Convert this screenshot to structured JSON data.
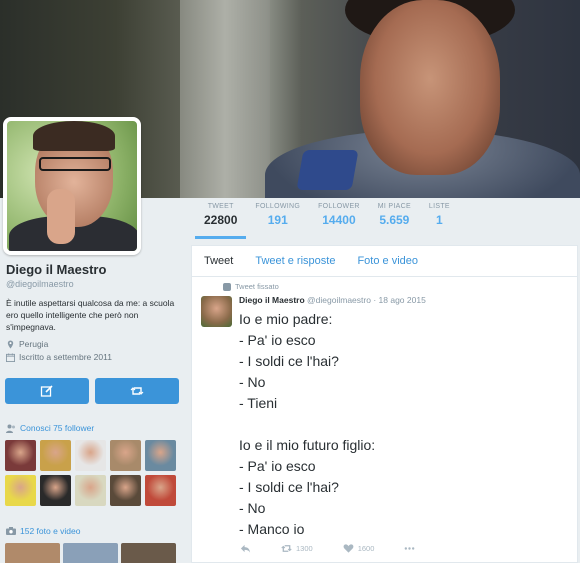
{
  "profile": {
    "name": "Diego il Maestro",
    "handle": "@diegoilmaestro",
    "bio": "È inutile aspettarsi qualcosa da me: a scuola ero quello intelligente che però non s'impegnava.",
    "location": "Perugia",
    "joined": "Iscritto a settembre 2011"
  },
  "stats": [
    {
      "label": "TWEET",
      "value": "22800"
    },
    {
      "label": "FOLLOWING",
      "value": "191"
    },
    {
      "label": "FOLLOWER",
      "value": "14400"
    },
    {
      "label": "MI PIACE",
      "value": "5.659"
    },
    {
      "label": "LISTE",
      "value": "1"
    }
  ],
  "tabs": [
    "Tweet",
    "Tweet e risposte",
    "Foto e video"
  ],
  "sidebar": {
    "followers_known": "Conosci 75 follower",
    "photos_videos": "152 foto e video",
    "follower_colors": [
      "#7a3a3a",
      "#c9a14a",
      "#e6e6e6",
      "#a88a6a",
      "#6a8aa0",
      "#e8d84a",
      "#2a2a2a",
      "#d8d8c0",
      "#5a4a3a",
      "#c04a3a"
    ],
    "photo_colors": [
      "#b08a6a",
      "#8aa0b8",
      "#6a5a4a"
    ]
  },
  "tweet": {
    "pinned_label": "Tweet fissato",
    "author": "Diego il Maestro",
    "handle": "@diegoilmaestro",
    "date": "18 ago 2015",
    "lines": [
      "Io e mio padre:",
      "- Pa' io esco",
      "- I soldi ce l'hai?",
      "- No",
      "- Tieni",
      "",
      "Io e il mio futuro figlio:",
      "- Pa' io esco",
      "- I soldi ce l'hai?",
      "- No",
      "- Manco io"
    ],
    "retweets": "1300",
    "likes": "1600"
  },
  "colors": {
    "accent": "#3b94d9",
    "link": "#55acee",
    "muted": "#8899a6"
  }
}
